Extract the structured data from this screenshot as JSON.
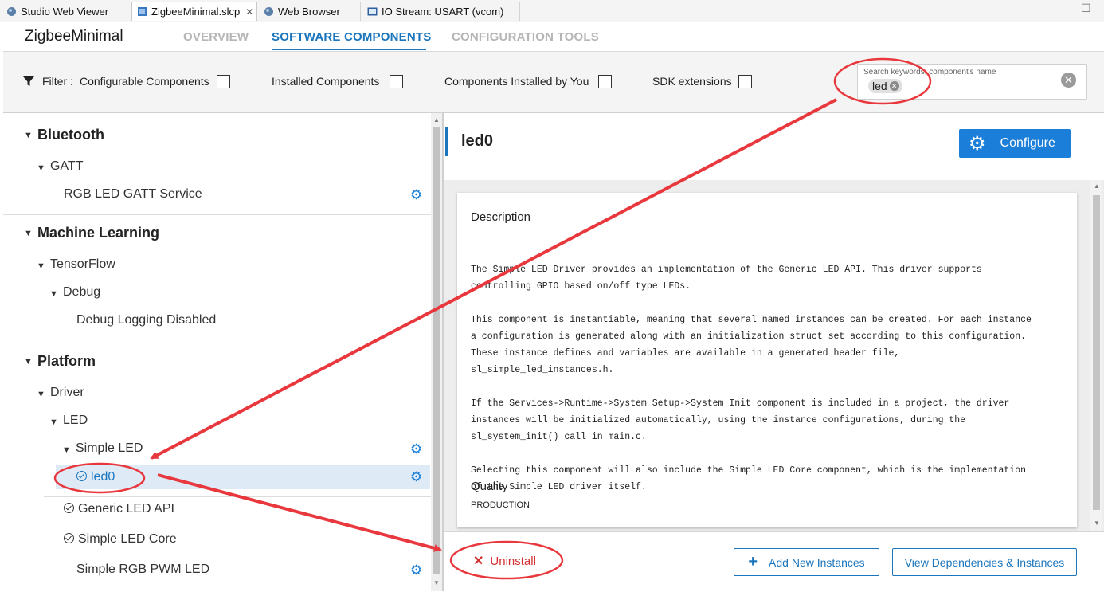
{
  "tabs": [
    {
      "label": "Studio Web Viewer",
      "icon": "globe-icon",
      "active": false
    },
    {
      "label": "ZigbeeMinimal.slcp",
      "icon": "project-icon",
      "active": true,
      "close": "✕"
    },
    {
      "label": "Web Browser",
      "icon": "globe-icon",
      "active": false
    },
    {
      "label": "IO Stream: USART (vcom)",
      "icon": "console-icon",
      "active": false
    }
  ],
  "app": {
    "title": "ZigbeeMinimal",
    "nav": [
      "OVERVIEW",
      "SOFTWARE COMPONENTS",
      "CONFIGURATION TOOLS"
    ],
    "active_nav": 1
  },
  "filter": {
    "label": "Filter :",
    "options": [
      "Configurable Components",
      "Installed Components",
      "Components Installed by You",
      "SDK extensions"
    ],
    "search_placeholder": "Search keywords, component's name",
    "search_chip": "led"
  },
  "tree": {
    "bluetooth": "Bluetooth",
    "gatt": "GATT",
    "rgb_led_gatt": "RGB LED GATT Service",
    "ml": "Machine Learning",
    "tensorflow": "TensorFlow",
    "debug": "Debug",
    "debug_logging": "Debug Logging Disabled",
    "platform": "Platform",
    "driver": "Driver",
    "led": "LED",
    "simple_led": "Simple LED",
    "led0": "led0",
    "generic_led_api": "Generic LED API",
    "simple_led_core": "Simple LED Core",
    "simple_rgb_pwm": "Simple RGB PWM LED"
  },
  "detail": {
    "title": "led0",
    "configure": "Configure",
    "description_heading": "Description",
    "description_lines": [
      "The Simple LED Driver provides an implementation of the Generic LED API. This driver supports",
      "controlling GPIO based on/off type LEDs.",
      "",
      "This component is instantiable, meaning that several named instances can be created. For each instance",
      "a configuration is generated along with an initialization struct set according to this configuration.",
      "These instance defines and variables are available in a generated header file,",
      "sl_simple_led_instances.h.",
      "",
      "If the Services->Runtime->System Setup->System Init component is included in a project, the driver",
      "instances will be initialized automatically, using the instance configurations, during the",
      "sl_system_init() call in main.c.",
      "",
      "Selecting this component will also include the Simple LED Core component, which is the implementation",
      "of the Simple LED driver itself."
    ],
    "quality_heading": "Quality",
    "quality_value": "PRODUCTION",
    "uninstall": "Uninstall",
    "add_instances": "Add New Instances",
    "view_deps": "View Dependencies & Instances"
  },
  "colors": {
    "accent": "#1b75bc",
    "annotation": "#e8383d",
    "uninstall": "#d32f2f"
  }
}
